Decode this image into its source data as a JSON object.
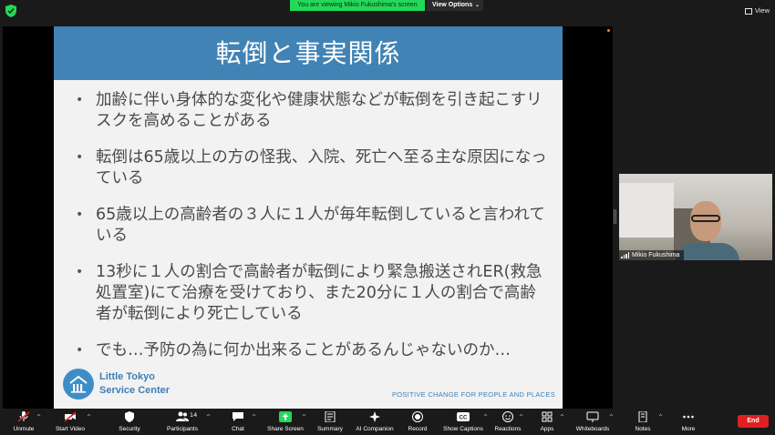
{
  "topbar": {
    "viewing_banner": "You are viewing Mikio Fukushima's screen",
    "view_options": "View Options",
    "view_label": "View"
  },
  "slide": {
    "title": "転倒と事実関係",
    "bullets": [
      "加齢に伴い身体的な変化や健康状態などが転倒を引き起こすリスクを高めることがある",
      "転倒は65歳以上の方の怪我、入院、死亡へ至る主な原因になっている",
      "65歳以上の高齢者の３人に１人が毎年転倒していると言われている",
      "13秒に１人の割合で高齢者が転倒により緊急搬送されER(救急処置室)にて治療を受けており、また20分に１人の割合で高齢者が転倒により死亡している",
      "でも…予防の為に何か出来ることがあるんじゃないのか…"
    ],
    "logo_line1": "Little Tokyo",
    "logo_line2": "Service Center",
    "tagline": "POSITIVE CHANGE FOR PEOPLE AND PLACES"
  },
  "video": {
    "participant_name": "Mikio Fukushima"
  },
  "toolbar": {
    "unmute": "Unmute",
    "start_video": "Start Video",
    "security": "Security",
    "participants": "Participants",
    "participants_count": "14",
    "chat": "Chat",
    "share_screen": "Share Screen",
    "summary": "Summary",
    "ai_companion": "AI Companion",
    "record": "Record",
    "show_captions": "Show Captions",
    "reactions": "Reactions",
    "apps": "Apps",
    "whiteboards": "Whiteboards",
    "notes": "Notes",
    "more": "More",
    "end": "End"
  },
  "colors": {
    "banner_green": "#23d959",
    "share_green": "#23d959",
    "slide_header_blue": "#4183b5",
    "end_red": "#e02020"
  }
}
